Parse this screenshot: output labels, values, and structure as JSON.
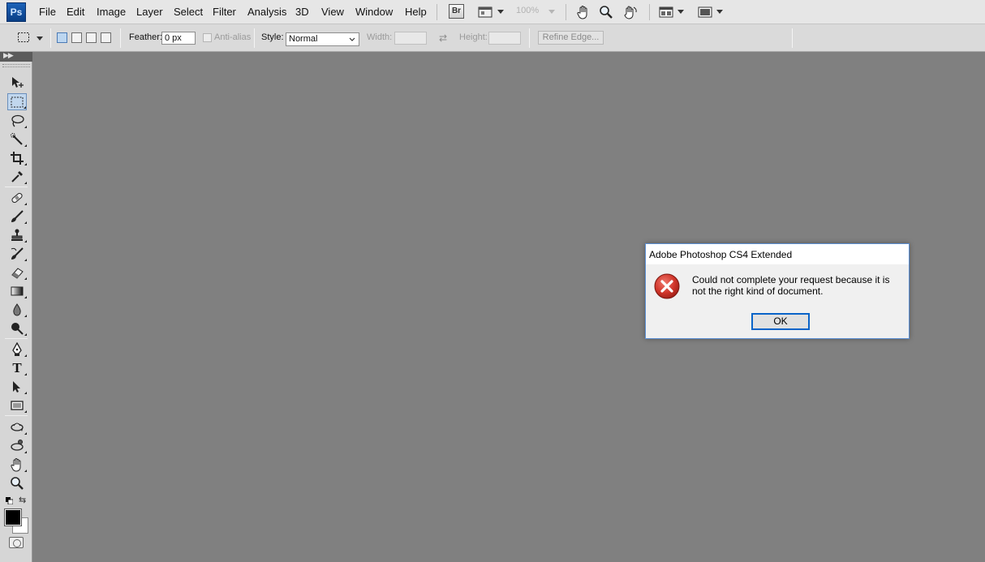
{
  "app": {
    "logo_text": "Ps"
  },
  "menubar": {
    "items": [
      "File",
      "Edit",
      "Image",
      "Layer",
      "Select",
      "Filter",
      "Analysis",
      "3D",
      "View",
      "Window",
      "Help"
    ],
    "bridge_label": "Br",
    "zoom_level": "100%"
  },
  "options": {
    "feather_label": "Feather:",
    "feather_value": "0 px",
    "antialias_label": "Anti-alias",
    "style_label": "Style:",
    "style_value": "Normal",
    "width_label": "Width:",
    "height_label": "Height:",
    "refine_edge_label": "Refine Edge..."
  },
  "toolbox": {
    "tools": [
      "move-tool",
      "rectangular-marquee-tool",
      "lasso-tool",
      "quick-selection-tool",
      "crop-tool",
      "eyedropper-tool",
      "spot-healing-brush-tool",
      "brush-tool",
      "clone-stamp-tool",
      "history-brush-tool",
      "eraser-tool",
      "gradient-tool",
      "blur-tool",
      "dodge-tool",
      "pen-tool",
      "type-tool",
      "path-selection-tool",
      "rectangle-tool",
      "3d-rotate-tool",
      "3d-orbit-tool",
      "hand-tool",
      "zoom-tool"
    ],
    "active_tool": "rectangular-marquee-tool",
    "type_tool_glyph": "T",
    "foreground_color": "#000000",
    "background_color": "#ffffff"
  },
  "dialog": {
    "title": "Adobe Photoshop CS4 Extended",
    "message": "Could not complete your request because it is not the right kind of document.",
    "ok_label": "OK"
  },
  "colors": {
    "canvas_bg": "#808080",
    "dialog_border": "#5b8fd4",
    "error_red": "#c42b1c"
  }
}
